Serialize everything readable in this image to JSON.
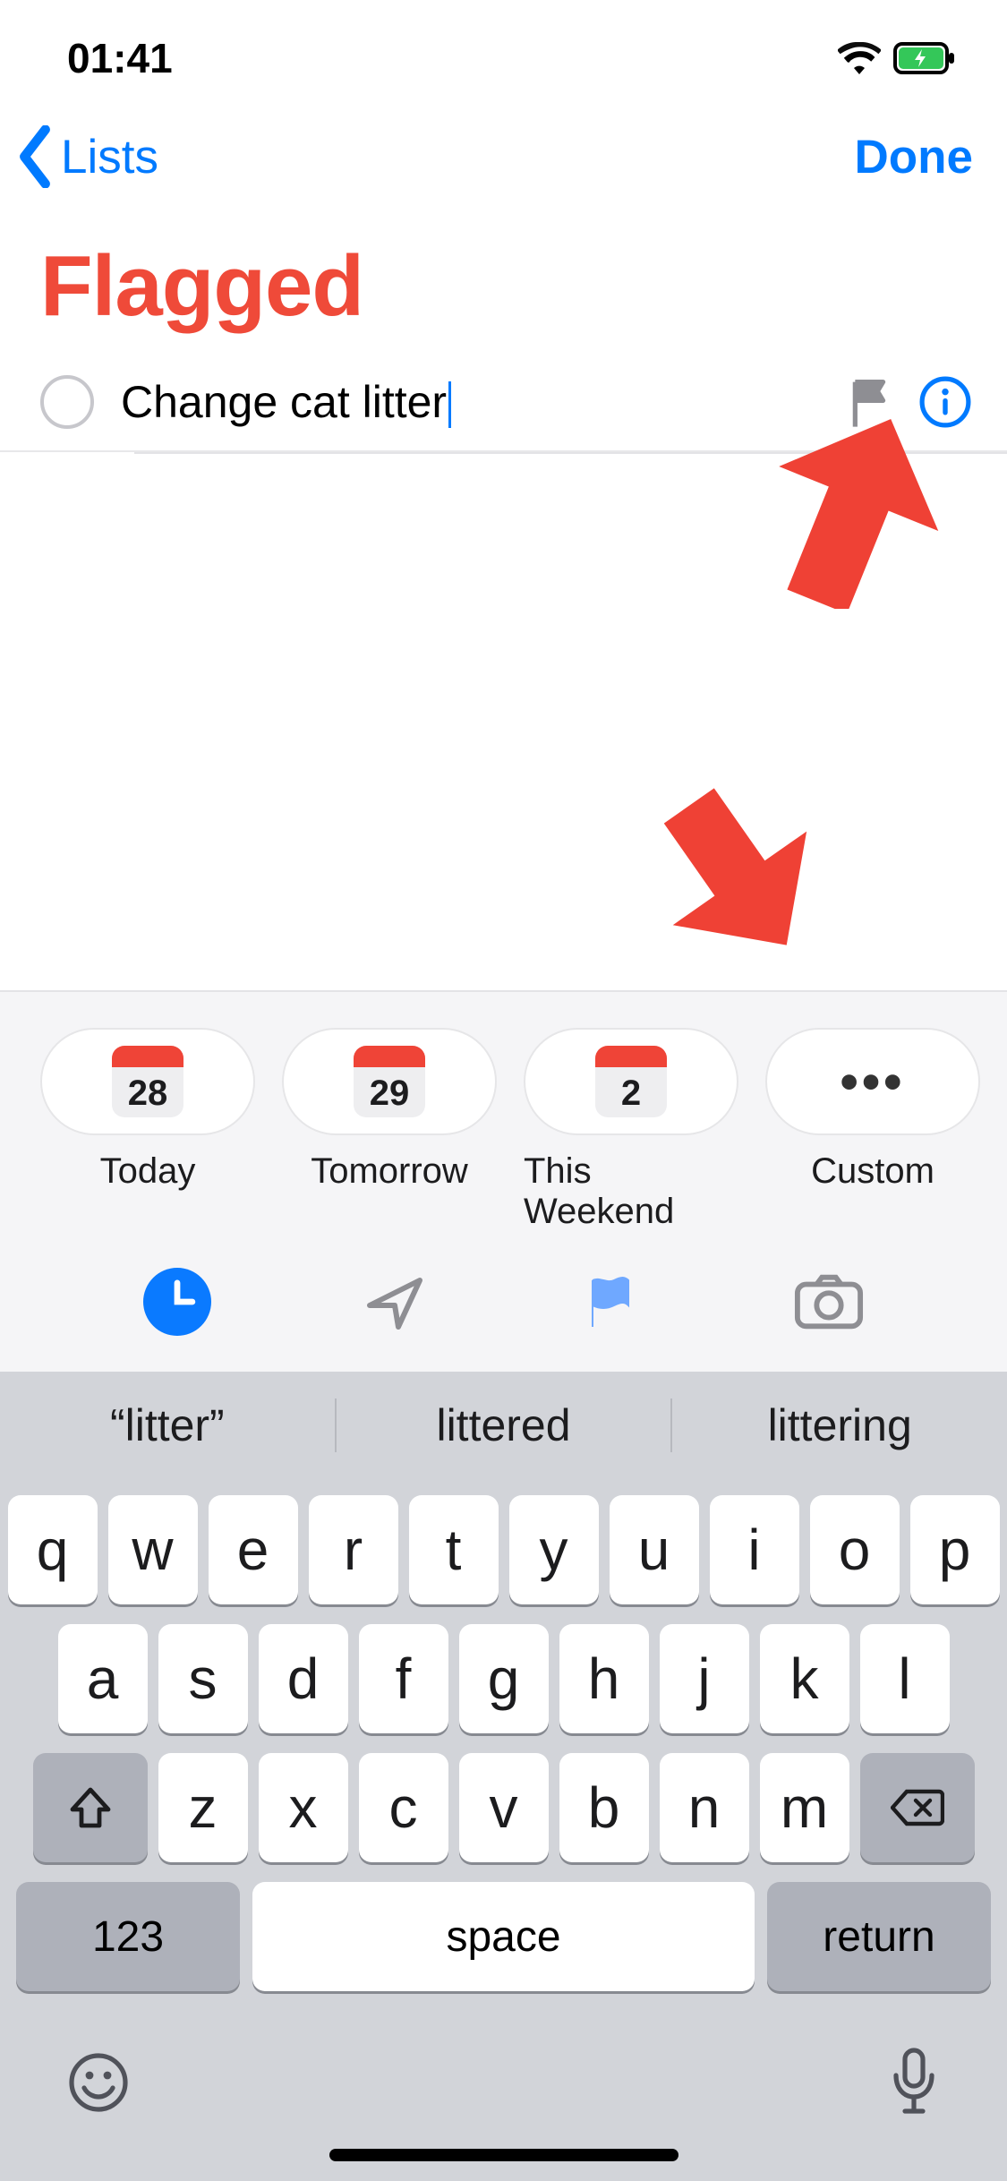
{
  "status": {
    "time": "01:41"
  },
  "nav": {
    "back_label": "Lists",
    "done_label": "Done"
  },
  "title": "Flagged",
  "reminder": {
    "text": "Change cat litter"
  },
  "quick": {
    "items": [
      {
        "day": "28",
        "label": "Today"
      },
      {
        "day": "29",
        "label": "Tomorrow"
      },
      {
        "day": "2",
        "label": "This Weekend"
      }
    ],
    "custom_label": "Custom"
  },
  "suggestions": [
    "“litter”",
    "littered",
    "littering"
  ],
  "keyboard": {
    "row1": [
      "q",
      "w",
      "e",
      "r",
      "t",
      "y",
      "u",
      "i",
      "o",
      "p"
    ],
    "row2": [
      "a",
      "s",
      "d",
      "f",
      "g",
      "h",
      "j",
      "k",
      "l"
    ],
    "row3": [
      "z",
      "x",
      "c",
      "v",
      "b",
      "n",
      "m"
    ],
    "numbers_label": "123",
    "space_label": "space",
    "return_label": "return"
  }
}
